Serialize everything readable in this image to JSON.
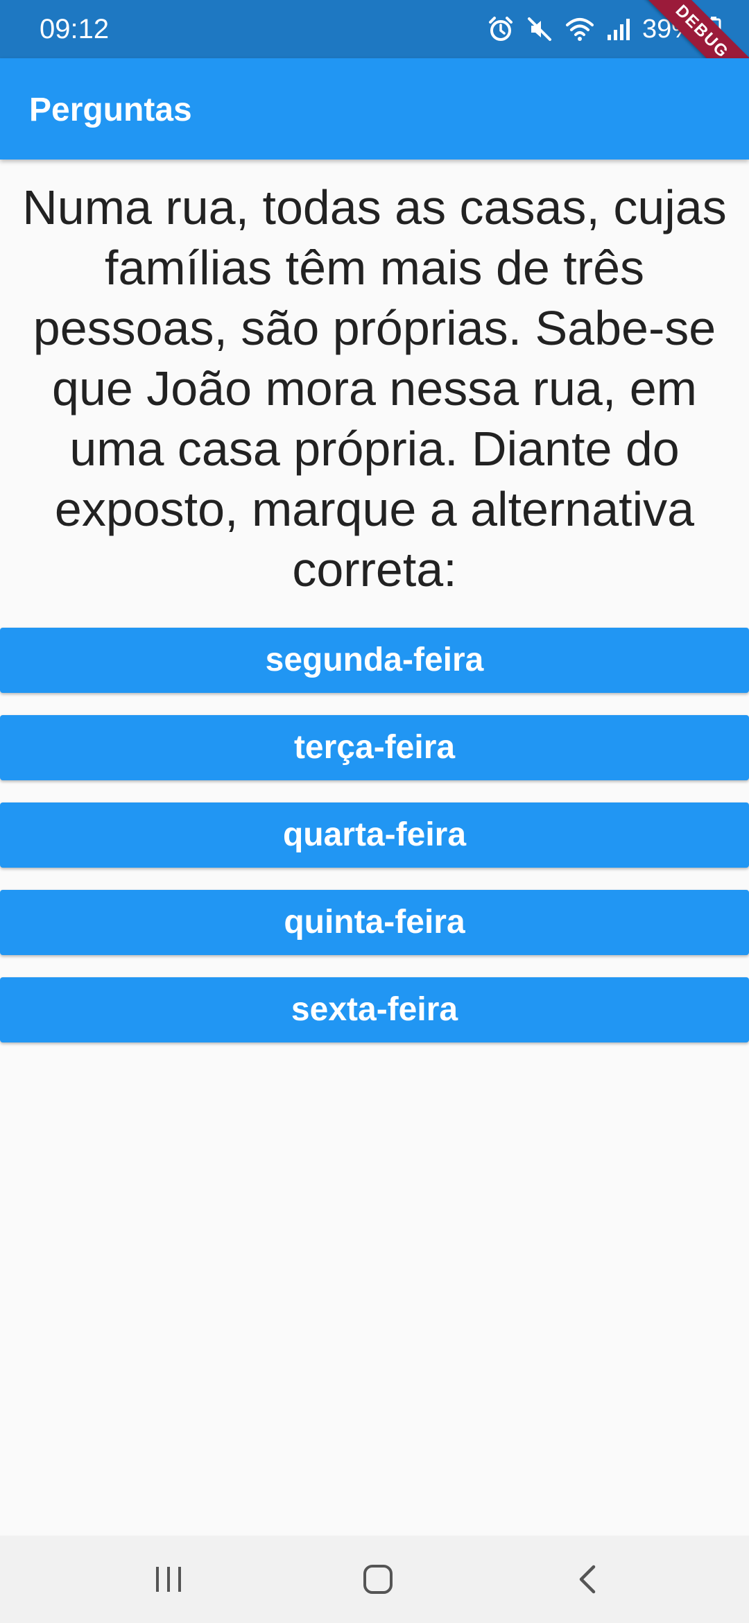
{
  "status_bar": {
    "time": "09:12",
    "battery": "39%",
    "icons": [
      "alarm-icon",
      "mute-icon",
      "wifi-icon",
      "signal-icon",
      "battery-icon"
    ]
  },
  "debug_banner": "DEBUG",
  "app_bar": {
    "title": "Perguntas"
  },
  "question": {
    "text": "Numa rua, todas as casas, cujas famílias têm mais de três pessoas, são próprias. Sabe-se que João mora nessa rua, em uma casa própria. Diante do exposto, marque a alternativa correta:"
  },
  "answers": [
    {
      "label": "segunda-feira"
    },
    {
      "label": "terça-feira"
    },
    {
      "label": "quarta-feira"
    },
    {
      "label": "quinta-feira"
    },
    {
      "label": "sexta-feira"
    }
  ],
  "nav_bar": {
    "buttons": [
      "recent-apps-icon",
      "home-icon",
      "back-icon"
    ]
  },
  "colors": {
    "primary": "#2196f3",
    "status_bar": "#1e78c2",
    "background": "#fafafa",
    "text": "#222222",
    "debug_banner": "#9b1b3a"
  }
}
